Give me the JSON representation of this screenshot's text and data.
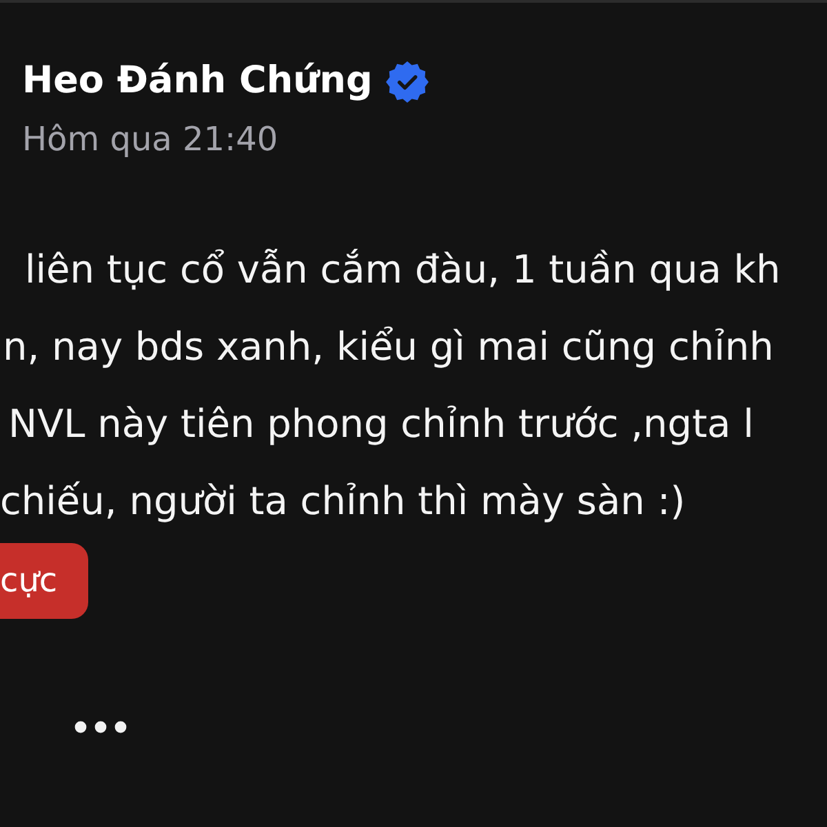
{
  "post": {
    "author": {
      "name": "Heo Đánh Chứng",
      "verified": true
    },
    "timestamp": "Hôm qua 21:40",
    "text_lines": [
      "liên tục cổ vẫn cắm đàu, 1 tuần qua kh",
      "n, nay bds xanh, kiểu gì mai cũng chỉnh",
      "NVL này tiên phong chỉnh trước ,ngta l",
      "chiếu, người ta chỉnh thì mày sàn :)"
    ],
    "tag": {
      "label": "cực"
    }
  }
}
